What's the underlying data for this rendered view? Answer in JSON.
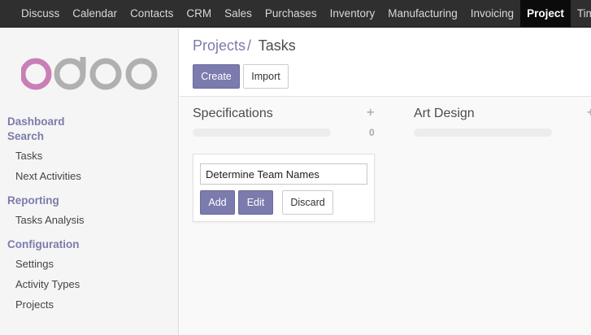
{
  "topnav": {
    "items": [
      "Discuss",
      "Calendar",
      "Contacts",
      "CRM",
      "Sales",
      "Purchases",
      "Inventory",
      "Manufacturing",
      "Invoicing",
      "Project",
      "Timesh"
    ],
    "active": "Project"
  },
  "brand": {
    "logo_text": "odoo",
    "colors": {
      "o_first": "#c97fb5",
      "rest": "#b0b0b0"
    }
  },
  "sidebar": {
    "dashboard": "Dashboard",
    "search": "Search",
    "search_items": [
      "Tasks",
      "Next Activities"
    ],
    "reporting": "Reporting",
    "reporting_items": [
      "Tasks Analysis"
    ],
    "configuration": "Configuration",
    "configuration_items": [
      "Settings",
      "Activity Types",
      "Projects"
    ]
  },
  "breadcrumb": {
    "parent": "Projects",
    "separator": "/",
    "current": "Tasks"
  },
  "buttons": {
    "create": "Create",
    "import": "Import"
  },
  "kanban": {
    "columns": [
      {
        "title": "Specifications",
        "plus": "+",
        "count": "0"
      },
      {
        "title": "Art Design",
        "plus": "+"
      }
    ],
    "quick_create": {
      "input_value": "Determine Team Names",
      "add": "Add",
      "edit": "Edit",
      "discard": "Discard"
    }
  },
  "colors": {
    "accent": "#7c7bad",
    "topbar": "#2f2f2f"
  }
}
